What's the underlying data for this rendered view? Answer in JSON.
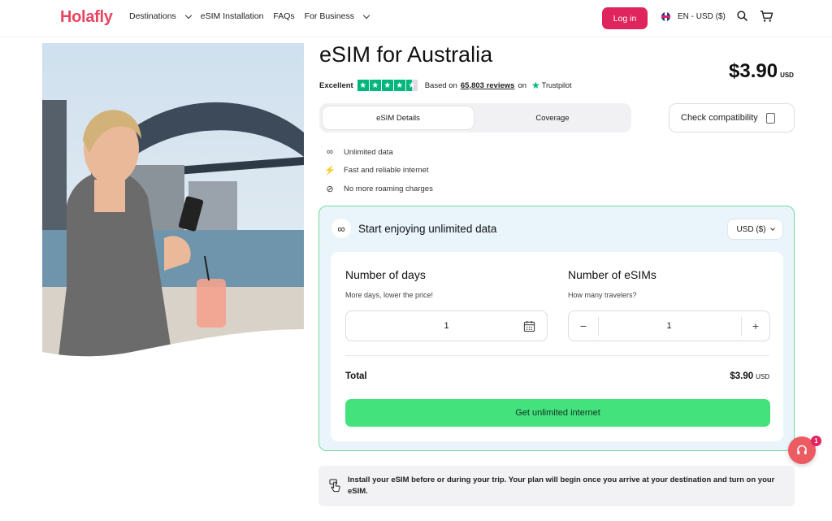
{
  "header": {
    "logo": "Holafly",
    "nav": [
      {
        "label": "Destinations",
        "has_menu": true
      },
      {
        "label": "eSIM Installation",
        "has_menu": false
      },
      {
        "label": "FAQs",
        "has_menu": false
      },
      {
        "label": "For Business",
        "has_menu": true
      }
    ],
    "login_label": "Log in",
    "language_label": "EN - USD ($)",
    "icons": [
      "search-icon",
      "cart-icon"
    ]
  },
  "product": {
    "title": "eSIM for Australia",
    "price": "$3.90",
    "price_currency": "USD",
    "rating": {
      "label": "Excellent",
      "stars": 4.5,
      "based_on": "Based on",
      "reviews": "65,803 reviews",
      "on": "on",
      "provider": "Trustpilot"
    },
    "tabs": [
      {
        "label": "eSIM Details",
        "active": true
      },
      {
        "label": "Coverage",
        "active": false
      }
    ],
    "compat_label": "Check compatibility",
    "features": [
      {
        "icon": "infinity-icon",
        "label": "Unlimited data"
      },
      {
        "icon": "lightning-icon",
        "label": "Fast and reliable internet"
      },
      {
        "icon": "no-roaming-icon",
        "label": "No more roaming charges"
      }
    ]
  },
  "plan": {
    "title": "Start enjoying unlimited data",
    "currency_select": "USD ($)",
    "days": {
      "label": "Number of days",
      "sub": "More days, lower the price!",
      "value": "1"
    },
    "esims": {
      "label": "Number of eSIMs",
      "sub": "How many travelers?",
      "value": "1",
      "minus": "−",
      "plus": "+"
    },
    "total_label": "Total",
    "total_value": "$3.90",
    "total_currency": "USD",
    "cta_label": "Get unlimited internet"
  },
  "notice": {
    "text": "Install your eSIM before or during your trip. Your plan will begin once you arrive at your destination and turn on your eSIM."
  },
  "chat": {
    "badge": "1"
  },
  "colors": {
    "brand": "#e0245e",
    "cta": "#44e27c",
    "card_border": "#6fdca0",
    "card_bg": "#e9f5fb",
    "trustpilot": "#00b67a"
  }
}
